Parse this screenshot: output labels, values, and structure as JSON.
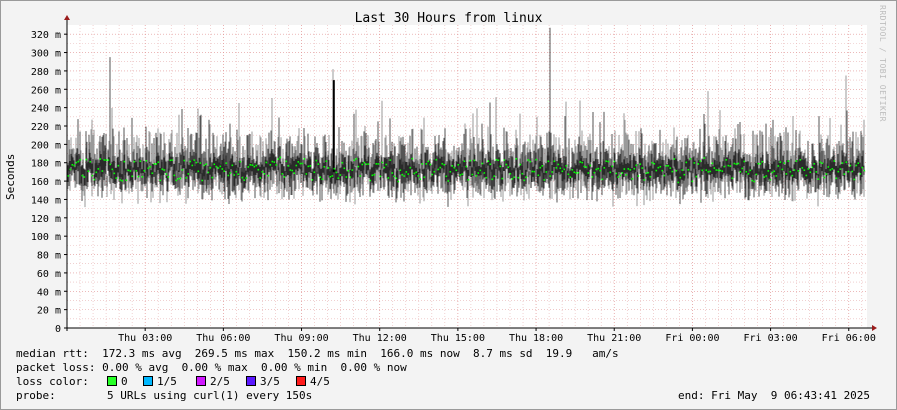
{
  "chart_data": {
    "type": "line",
    "title": "Last 30 Hours from linux",
    "ylabel": "Seconds",
    "xlabel": "",
    "ylim": [
      0,
      0.33
    ],
    "y_ticks": [
      {
        "v": 0,
        "label": "0"
      },
      {
        "v": 0.02,
        "label": "20 m"
      },
      {
        "v": 0.04,
        "label": "40 m"
      },
      {
        "v": 0.06,
        "label": "60 m"
      },
      {
        "v": 0.08,
        "label": "80 m"
      },
      {
        "v": 0.1,
        "label": "100 m"
      },
      {
        "v": 0.12,
        "label": "120 m"
      },
      {
        "v": 0.14,
        "label": "140 m"
      },
      {
        "v": 0.16,
        "label": "160 m"
      },
      {
        "v": 0.18,
        "label": "180 m"
      },
      {
        "v": 0.2,
        "label": "200 m"
      },
      {
        "v": 0.22,
        "label": "220 m"
      },
      {
        "v": 0.24,
        "label": "240 m"
      },
      {
        "v": 0.26,
        "label": "260 m"
      },
      {
        "v": 0.28,
        "label": "280 m"
      },
      {
        "v": 0.3,
        "label": "300 m"
      },
      {
        "v": 0.32,
        "label": "320 m"
      }
    ],
    "x_range_hours": [
      0,
      30
    ],
    "x_ticks": [
      {
        "h": 3,
        "label": "Thu 03:00"
      },
      {
        "h": 6,
        "label": "Thu 06:00"
      },
      {
        "h": 9,
        "label": "Thu 09:00"
      },
      {
        "h": 12,
        "label": "Thu 12:00"
      },
      {
        "h": 15,
        "label": "Thu 15:00"
      },
      {
        "h": 18,
        "label": "Thu 18:00"
      },
      {
        "h": 21,
        "label": "Thu 21:00"
      },
      {
        "h": 24,
        "label": "Fri 00:00"
      },
      {
        "h": 27,
        "label": "Fri 03:00"
      },
      {
        "h": 30,
        "label": "Fri 06:00"
      }
    ],
    "series": [
      {
        "name": "median rtt",
        "color": "#00ff00",
        "avg": 0.1723,
        "max": 0.2695,
        "min": 0.1502,
        "now": 0.166,
        "sd": 0.0087
      }
    ],
    "spikes": [
      {
        "h": 1.65,
        "v": 0.295
      },
      {
        "h": 10.2,
        "v": 0.282
      },
      {
        "h": 18.55,
        "v": 0.327
      },
      {
        "h": 24.6,
        "v": 0.258
      },
      {
        "h": 29.9,
        "v": 0.275
      }
    ],
    "grid": true,
    "background": "#ffffff",
    "grid_color": "#e8b4b4"
  },
  "watermark": "RRDTOOL / TOBI OETIKER",
  "stats": {
    "rtt_line": "median rtt:  172.3 ms avg  269.5 ms max  150.2 ms min  166.0 ms now  8.7 ms sd  19.9   am/s",
    "loss_line": "packet loss: 0.00 % avg  0.00 % max  0.00 % min  0.00 % now",
    "loss_color_label": "loss color:",
    "loss_colors": [
      {
        "label": "0",
        "color": "#26ff26"
      },
      {
        "label": "1/5",
        "color": "#00b8ff"
      },
      {
        "label": "2/5",
        "color": "#d017ff"
      },
      {
        "label": "3/5",
        "color": "#5a17ff"
      },
      {
        "label": "4/5",
        "color": "#ff1b1b"
      }
    ],
    "probe_label": "probe:",
    "probe_text": "5 URLs using curl(1) every 150s",
    "end_text": "end: Fri May  9 06:43:41 2025"
  }
}
